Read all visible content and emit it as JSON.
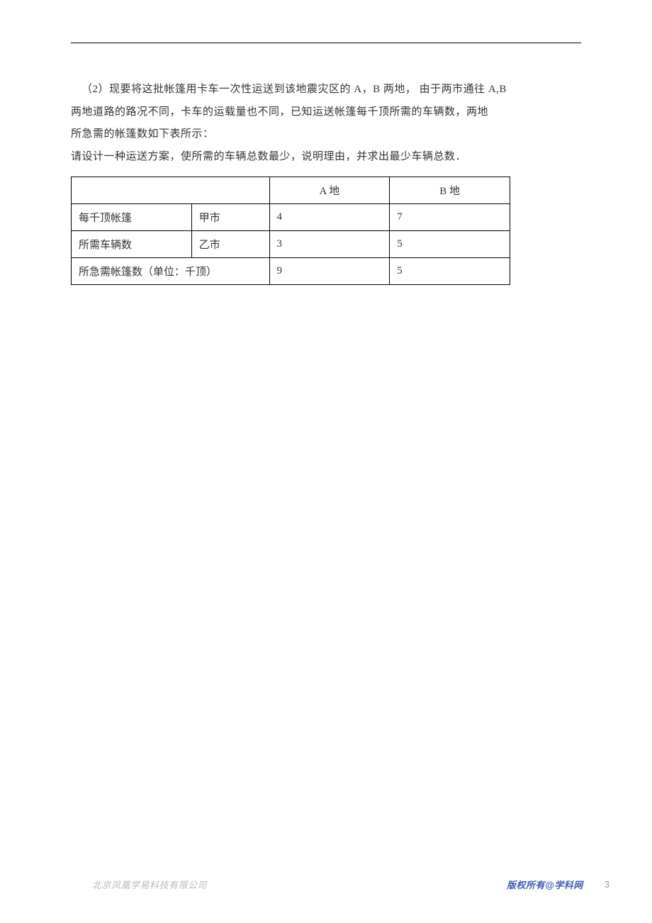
{
  "body": {
    "line1": "（2）现要将这批帐篷用卡车一次性运送到该地震灾区的 A，B 两地，  由于两市通往 A,B",
    "line2": "两地道路的路况不同，卡车的运载量也不同，已知运送帐篷每千顶所需的车辆数，两地",
    "line3": "所急需的帐篷数如下表所示：",
    "line4": "请设计一种运送方案，使所需的车辆总数最少，说明理由，并求出最少车辆总数．"
  },
  "table": {
    "header": {
      "blank": "",
      "colA": "A 地",
      "colB": "B 地"
    },
    "rows": [
      {
        "label1": "每千顶帐篷",
        "label2": "甲市",
        "a": "4",
        "b": "7"
      },
      {
        "label1": "所需车辆数",
        "label2": "乙市",
        "a": "3",
        "b": "5"
      }
    ],
    "footer_row": {
      "label": "所急需帐篷数（单位：千顶）",
      "a": "9",
      "b": "5"
    }
  },
  "footer": {
    "company": "北京凤凰学易科技有限公司",
    "copyright_prefix": "版权所有",
    "copyright_at": "@",
    "copyright_site": "学科网",
    "page_number": "3"
  }
}
